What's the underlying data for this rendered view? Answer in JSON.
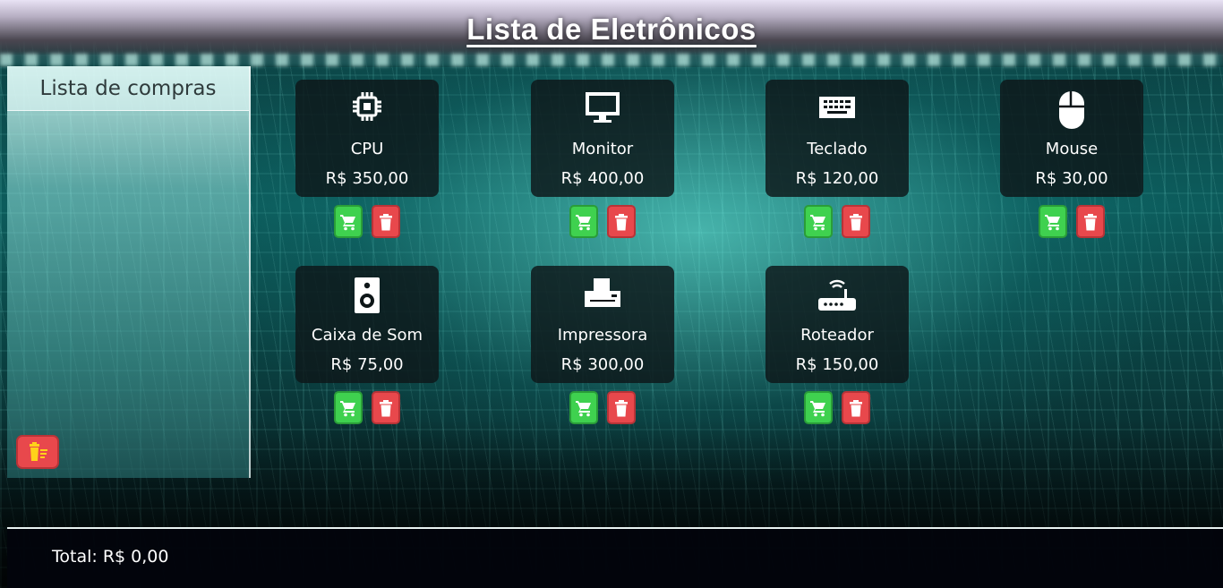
{
  "page": {
    "title": "Lista de Eletrônicos"
  },
  "sidebar": {
    "title": "Lista de compras",
    "clear_icon": "clear-list-icon"
  },
  "products": [
    {
      "name": "CPU",
      "price": "R$ 350,00",
      "icon": "cpu-icon"
    },
    {
      "name": "Monitor",
      "price": "R$ 400,00",
      "icon": "monitor-icon"
    },
    {
      "name": "Teclado",
      "price": "R$ 120,00",
      "icon": "keyboard-icon"
    },
    {
      "name": "Mouse",
      "price": "R$ 30,00",
      "icon": "mouse-icon"
    },
    {
      "name": "Caixa de Som",
      "price": "R$ 75,00",
      "icon": "speaker-icon"
    },
    {
      "name": "Impressora",
      "price": "R$ 300,00",
      "icon": "printer-icon"
    },
    {
      "name": "Roteador",
      "price": "R$ 150,00",
      "icon": "router-icon"
    }
  ],
  "footer": {
    "total": "Total: R$ 0,00"
  },
  "colors": {
    "add": "#3fd14f",
    "remove": "#e8484c",
    "card_bg": "#0e1618"
  }
}
